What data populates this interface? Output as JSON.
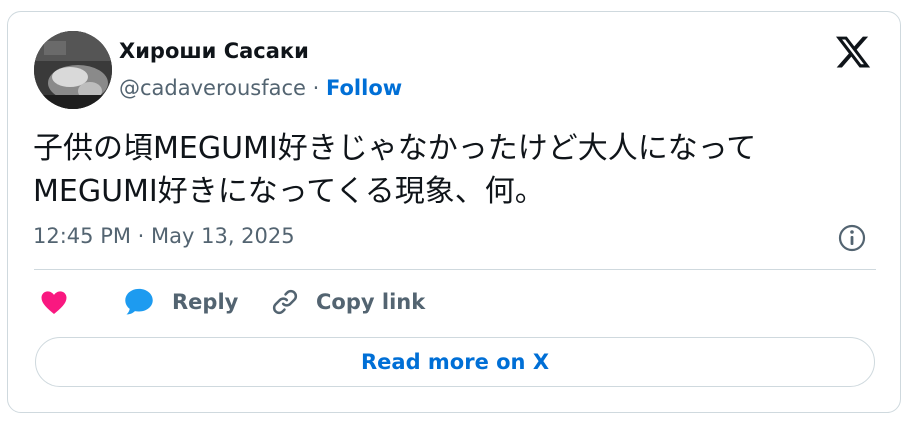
{
  "author": {
    "display_name": "Хироши Сасаки",
    "handle": "@cadaverousface",
    "separator": " · ",
    "follow_label": "Follow"
  },
  "tweet": {
    "text_line1": "子供の頃MEGUMI好きじゃなかったけど大人になって",
    "text_line2": "MEGUMI好きになってくる現象、何。",
    "timestamp": "12:45 PM · May 13, 2025"
  },
  "actions": {
    "reply_label": "Reply",
    "copy_link_label": "Copy link"
  },
  "read_more_label": "Read more on X",
  "icons": {
    "like": "heart-icon",
    "reply": "speech-bubble-icon",
    "copy_link": "link-icon",
    "info": "info-icon",
    "brand": "x-logo-icon"
  },
  "colors": {
    "text_primary": "#0f1419",
    "text_secondary": "#536471",
    "link_blue": "#006fd6",
    "like_pink": "#f91880",
    "reply_blue": "#1d9bf0",
    "border": "#cfd9de"
  }
}
